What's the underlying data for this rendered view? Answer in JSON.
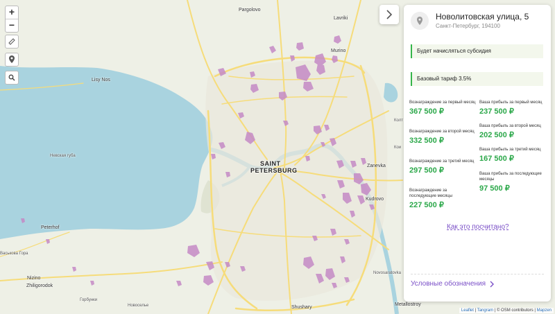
{
  "map": {
    "places": {
      "pargolovo": "Pargolovo",
      "lavriki": "Lavriki",
      "murino": "Murino",
      "lisy_nos": "Lisy Nos",
      "nevskaya_guba": "Невская губа",
      "saint": "SAINT",
      "petersburg": "PETERSBURG",
      "zanevka": "Zanevka",
      "kudrovo": "Kudrovo",
      "peterhof": "Peterhof",
      "vaskovaya_gora": "Васькова Гора",
      "nizino": "Nizino",
      "zhiligorodok": "Zhiligorodok",
      "gorbunki": "Горбунки",
      "novoselye": "Новоселье",
      "novosaratovka": "Novosaratovka",
      "shushary": "Shushary",
      "metallostroy": "Metallostroy",
      "kolt": "Колт",
      "koi": "Кои"
    },
    "controls": {
      "zoom_in": "+",
      "zoom_out": "−"
    },
    "attribution": {
      "leaflet": "Leaflet",
      "sep1": "|",
      "tangram": "Tangram",
      "osm": "| © OSM contributors |",
      "mapzen": "Mapzen"
    }
  },
  "panel": {
    "address_title": "Новолитовская улица, 5",
    "address_subtitle": "Санкт-Петербург, 194100",
    "subsidy_text": "Будет начисляться субсидия",
    "tariff_text": "Базовый тариф 3.5%",
    "rewards": [
      {
        "label": "Вознаграждение за первый месяц",
        "value": "367 500 ₽"
      },
      {
        "label": "Вознаграждение за второй месяц",
        "value": "332 500 ₽"
      },
      {
        "label": "Вознаграждение за третий месяц",
        "value": "297 500 ₽"
      },
      {
        "label": "Вознаграждение за последующие месяцы",
        "value": "227 500 ₽"
      }
    ],
    "profits": [
      {
        "label": "Ваша прибыль за первый месяц",
        "value": "237 500 ₽"
      },
      {
        "label": "Ваша прибыль за второй месяц",
        "value": "202 500 ₽"
      },
      {
        "label": "Ваша прибыль за третий месяц",
        "value": "167 500 ₽"
      },
      {
        "label": "Ваша прибыль за последующие месяцы",
        "value": "97 500 ₽"
      }
    ],
    "calc_link": "Как это посчитано?",
    "legend_link": "Условные обозначения"
  },
  "colors": {
    "accent_green": "#2ca84a",
    "link_purple": "#7a4fc7",
    "zone_purple": "#c58ac6",
    "water": "#a9d3df",
    "road_yellow": "#f6dc7a"
  }
}
